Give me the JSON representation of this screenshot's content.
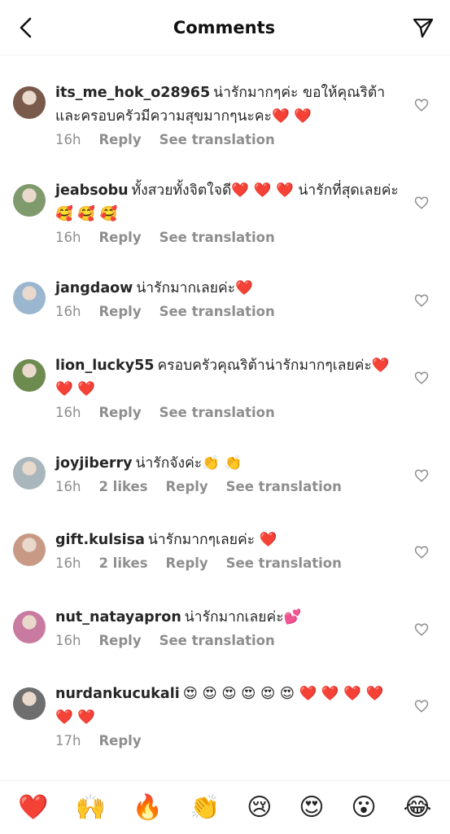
{
  "header": {
    "title": "Comments",
    "back_icon": "chevron-left-icon",
    "send_icon": "paper-plane-icon"
  },
  "comments": [
    {
      "user": "its_me_hok_o28965",
      "text": "น่ารักมากๆค่ะ ขอให้คุณริต้าและครอบครัวมีความสุขมากๆนะคะ❤️ ❤️",
      "time": "16h",
      "likes": "",
      "reply": "Reply",
      "translate": "See translation",
      "avatar_color": "#7a5a4a"
    },
    {
      "user": "jeabsobu",
      "text": "ทั้งสวยทั้งจิตใจดี❤️ ❤️ ❤️ น่ารักที่สุดเลยค่ะ🥰 🥰 🥰",
      "time": "16h",
      "likes": "",
      "reply": "Reply",
      "translate": "See translation",
      "avatar_color": "#7f9a6c"
    },
    {
      "user": "jangdaow",
      "text": "น่ารักมากเลยค่ะ❤️",
      "time": "16h",
      "likes": "",
      "reply": "Reply",
      "translate": "See translation",
      "avatar_color": "#9bb6cf"
    },
    {
      "user": "lion_lucky55",
      "text": "ครอบครัวคุณริต้าน่ารักมากๆเลยค่ะ❤️ ❤️ ❤️",
      "time": "16h",
      "likes": "",
      "reply": "Reply",
      "translate": "See translation",
      "avatar_color": "#6d8a4f"
    },
    {
      "user": "joyjiberry",
      "text": "น่ารักจังค่ะ👏 👏",
      "time": "16h",
      "likes": "2 likes",
      "reply": "Reply",
      "translate": "See translation",
      "avatar_color": "#a9b7bd"
    },
    {
      "user": "gift.kulsisa",
      "text": "น่ารักมากๆเลยค่ะ ❤️",
      "time": "16h",
      "likes": "2 likes",
      "reply": "Reply",
      "translate": "See translation",
      "avatar_color": "#c89a86"
    },
    {
      "user": "nut_natayapron",
      "text": "น่ารักมากเลยค่ะ💕",
      "time": "16h",
      "likes": "",
      "reply": "Reply",
      "translate": "See translation",
      "avatar_color": "#c97aa0"
    },
    {
      "user": "nurdankucukali",
      "text": "😍 😍 😍 😍 😍 😍 ❤️ ❤️ ❤️ ❤️ ❤️ ❤️",
      "time": "17h",
      "likes": "",
      "reply": "Reply",
      "translate": "",
      "avatar_color": "#6e6e6e"
    }
  ],
  "emoji_bar": [
    "❤️",
    "🙌",
    "🔥",
    "👏",
    "😢",
    "😍",
    "😮",
    "😂"
  ],
  "colors": {
    "text": "#262626",
    "meta": "#8e8e8e",
    "border": "#efefef",
    "heart": "#ed4956"
  }
}
